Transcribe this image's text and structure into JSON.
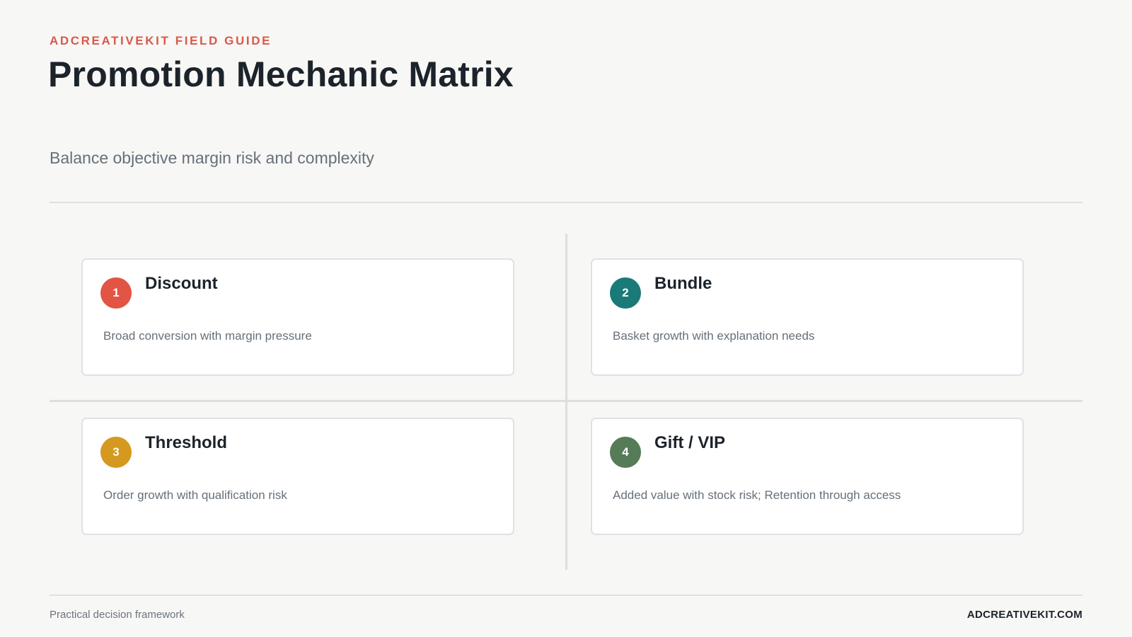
{
  "header": {
    "eyebrow": "ADCREATIVEKIT FIELD GUIDE",
    "title": "Promotion Mechanic Matrix",
    "subtitle": "Balance objective margin risk and complexity"
  },
  "quadrants": [
    {
      "number": "1",
      "title": "Discount",
      "description": "Broad conversion with margin pressure",
      "color": "#e25443"
    },
    {
      "number": "2",
      "title": "Bundle",
      "description": "Basket growth with explanation needs",
      "color": "#1a7a78"
    },
    {
      "number": "3",
      "title": "Threshold",
      "description": "Order growth with qualification risk",
      "color": "#d4991e"
    },
    {
      "number": "4",
      "title": "Gift / VIP",
      "description": "Added value with stock risk; Retention through access",
      "color": "#557b57"
    }
  ],
  "footer": {
    "left": "Practical decision framework",
    "right": "ADCREATIVEKIT.COM"
  }
}
